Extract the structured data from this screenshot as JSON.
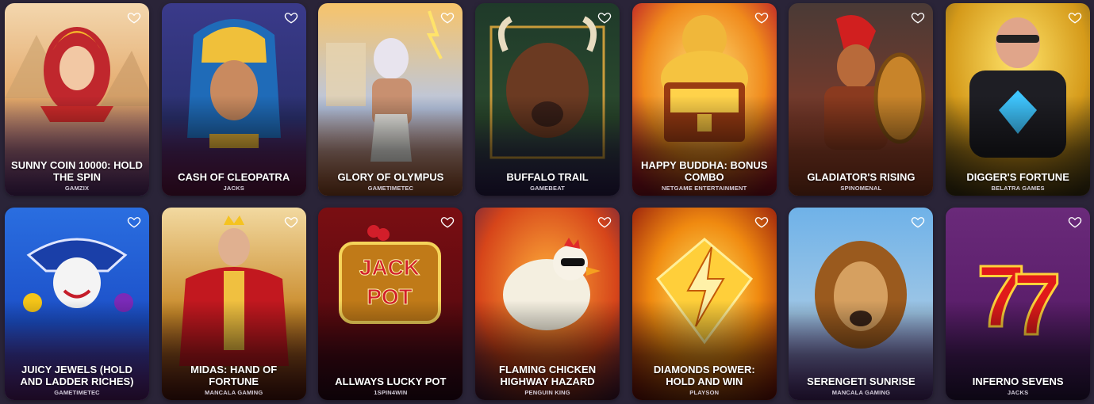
{
  "games": [
    {
      "title": "SUNNY COIN 10000: HOLD THE SPIN",
      "provider": "GAMZIX",
      "icon": "heart-icon"
    },
    {
      "title": "CASH OF CLEOPATRA",
      "provider": "JACKS",
      "icon": "heart-icon"
    },
    {
      "title": "GLORY OF OLYMPUS",
      "provider": "GAMETIMETEC",
      "icon": "heart-icon"
    },
    {
      "title": "BUFFALO TRAIL",
      "provider": "GAMEBEAT",
      "icon": "heart-icon"
    },
    {
      "title": "HAPPY BUDDHA: BONUS COMBO",
      "provider": "NETGAME ENTERTAINMENT",
      "icon": "heart-icon"
    },
    {
      "title": "GLADIATOR'S RISING",
      "provider": "SPINOMENAL",
      "icon": "heart-icon"
    },
    {
      "title": "DIGGER'S FORTUNE",
      "provider": "BELATRA GAMES",
      "icon": "heart-icon"
    },
    {
      "title": "JUICY JEWELS (HOLD AND LADDER RICHES)",
      "provider": "GAMETIMETEC",
      "icon": "heart-icon"
    },
    {
      "title": "MIDAS: HAND OF FORTUNE",
      "provider": "MANCALA GAMING",
      "icon": "heart-icon"
    },
    {
      "title": "ALLWAYS LUCKY POT",
      "provider": "1SPIN4WIN",
      "icon": "heart-icon"
    },
    {
      "title": "FLAMING CHICKEN HIGHWAY HAZARD",
      "provider": "PENGUIN KING",
      "icon": "heart-icon"
    },
    {
      "title": "DIAMONDS POWER: HOLD AND WIN",
      "provider": "PLAYSON",
      "icon": "heart-icon"
    },
    {
      "title": "SERENGETI SUNRISE",
      "provider": "MANCALA GAMING",
      "icon": "heart-icon"
    },
    {
      "title": "INFERNO SEVENS",
      "provider": "JACKS",
      "icon": "heart-icon"
    }
  ],
  "colors": {
    "background": "#2a2438",
    "accent": "#ffffff"
  }
}
